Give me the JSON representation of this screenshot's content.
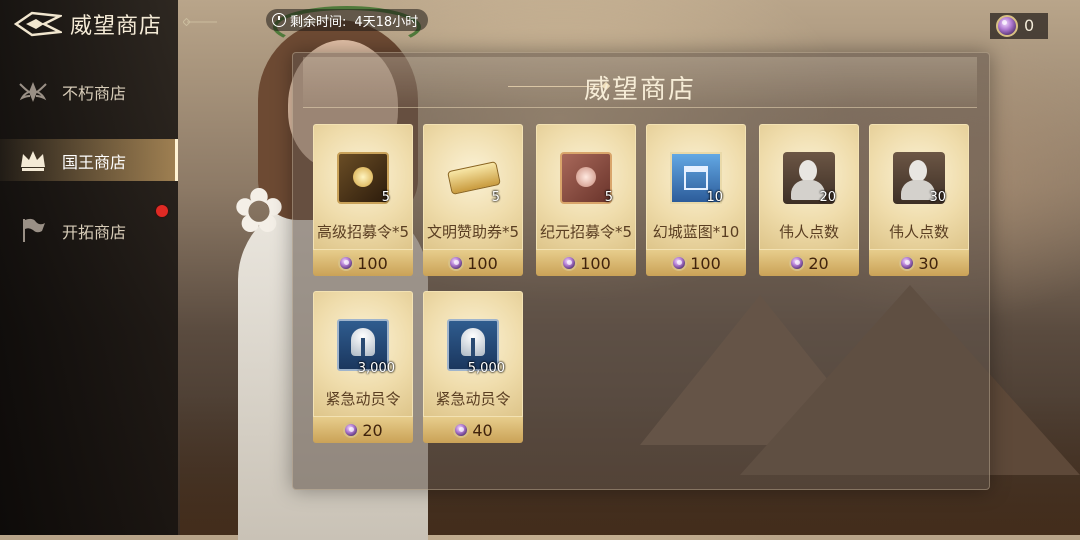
{
  "header": {
    "title": "威望商店",
    "timer_label": "剩余时间:",
    "timer_value": "4天18小时",
    "currency_amount": "0"
  },
  "sidebar": {
    "items": [
      {
        "label": "不朽商店",
        "icon": "winged-emblem-icon",
        "active": false,
        "badge": false
      },
      {
        "label": "国王商店",
        "icon": "crown-icon",
        "active": true,
        "badge": false
      },
      {
        "label": "开拓商店",
        "icon": "flag-icon",
        "active": false,
        "badge": true
      }
    ]
  },
  "panel": {
    "title": "威望商店",
    "items": [
      {
        "name": "高级招募令*5",
        "qty": "5",
        "price": "100",
        "icon": "advanced-recruit-scroll-icon"
      },
      {
        "name": "文明赞助券*5",
        "qty": "5",
        "price": "100",
        "icon": "civilization-ticket-icon"
      },
      {
        "name": "纪元招募令*5",
        "qty": "5",
        "price": "100",
        "icon": "era-recruit-scroll-icon"
      },
      {
        "name": "幻城蓝图*10",
        "qty": "10",
        "price": "100",
        "icon": "city-blueprint-icon"
      },
      {
        "name": "伟人点数",
        "qty": "20",
        "price": "20",
        "icon": "great-person-bust-icon"
      },
      {
        "name": "伟人点数",
        "qty": "30",
        "price": "30",
        "icon": "great-person-bust-icon"
      },
      {
        "name": "紧急动员令",
        "qty": "3,000",
        "price": "20",
        "icon": "emergency-mobilization-helmet-icon"
      },
      {
        "name": "紧急动员令",
        "qty": "5,000",
        "price": "40",
        "icon": "emergency-mobilization-helmet-icon"
      }
    ]
  },
  "colors": {
    "accent_gold": "#caa257",
    "card_bg": "#efdcab",
    "badge_red": "#e02a24",
    "currency_purple": "#b07ad1"
  }
}
